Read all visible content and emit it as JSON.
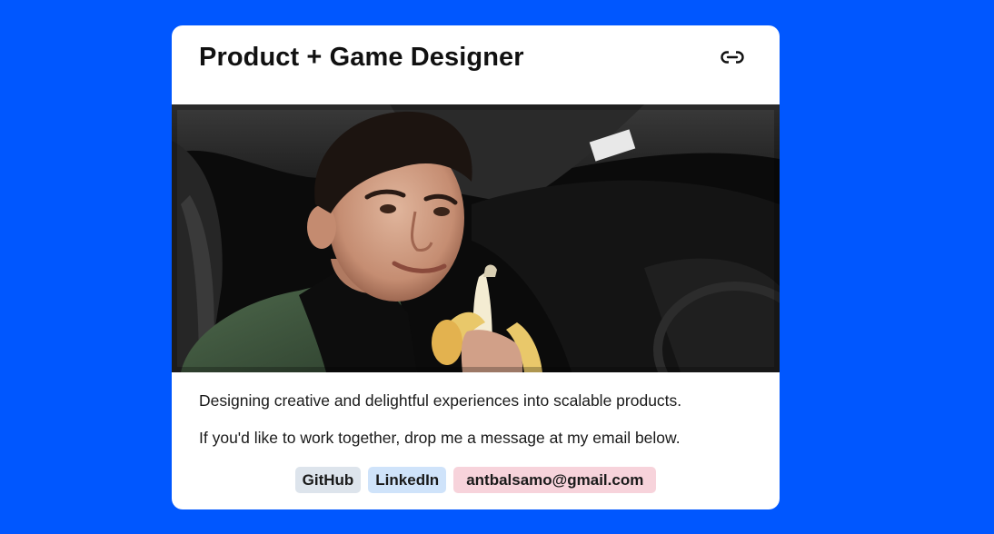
{
  "page": {
    "background_color": "#0057ff"
  },
  "card": {
    "title": "Product + Game Designer",
    "link_icon": "link-icon",
    "photo_alt": "Portrait of the designer in a car holding a banana",
    "description_1": "Designing creative and delightful experiences into scalable products.",
    "description_2": "If you'd like to work together, drop me a message at my email below.",
    "links": {
      "github_label": "GitHub",
      "github_color": "#dde4ec",
      "linkedin_label": "LinkedIn",
      "linkedin_color": "#cfe3fa",
      "email_label": "antbalsamo@gmail.com",
      "email_color": "#f7d3db"
    }
  }
}
